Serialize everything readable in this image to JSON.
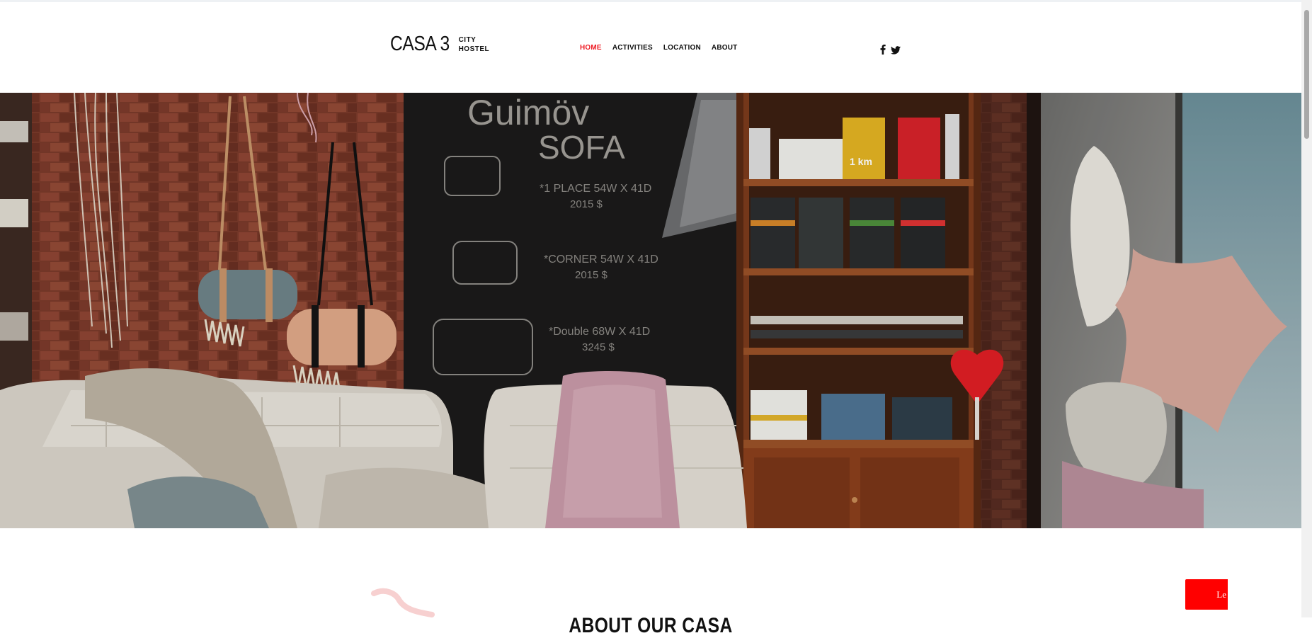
{
  "header": {
    "logo": {
      "main": "CASA 3",
      "sub_line1": "CITY",
      "sub_line2": "HOSTEL"
    },
    "nav": [
      {
        "label": "HOME",
        "active": true
      },
      {
        "label": "ACTIVITIES",
        "active": false
      },
      {
        "label": "LOCATION",
        "active": false
      },
      {
        "label": "ABOUT",
        "active": false
      }
    ],
    "social": [
      "facebook-icon",
      "twitter-icon"
    ]
  },
  "hero": {
    "chalkboard": {
      "line1": "Guimöv",
      "line2": "SOFA",
      "line3": "*1 PLACE 54W X 41D",
      "line4": "2015 $",
      "line5": "*CORNER 54W X 41D",
      "line6": "2015 $",
      "line7": "*Double 68W X 41D",
      "line8": "3245 $"
    },
    "book_label": "1 km"
  },
  "about": {
    "title": "ABOUT OUR CASA"
  },
  "cta": {
    "label": "Le"
  },
  "colors": {
    "accent": "#ee1c25",
    "cta": "#ff0000"
  }
}
